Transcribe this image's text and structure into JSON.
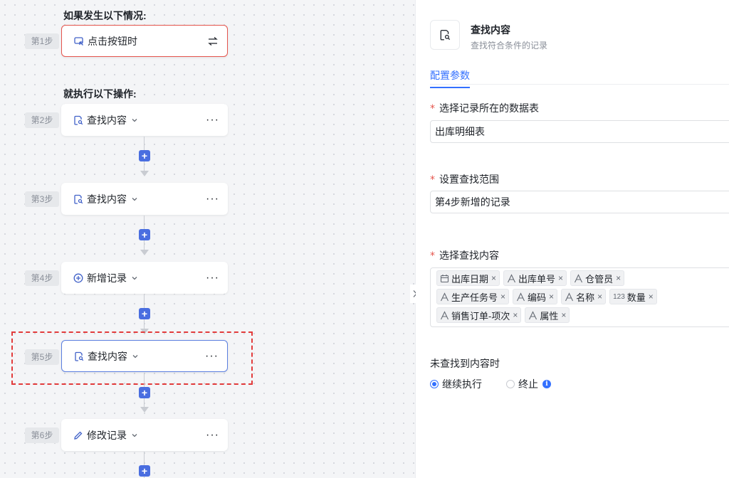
{
  "canvas": {
    "if_title": "如果发生以下情况:",
    "then_title": "就执行以下操作:",
    "steps": [
      {
        "tag": "第1步",
        "label": "点击按钮时",
        "icon": "mouse-click-icon",
        "type": "trigger"
      },
      {
        "tag": "第2步",
        "label": "查找内容",
        "icon": "find-record-icon"
      },
      {
        "tag": "第3步",
        "label": "查找内容",
        "icon": "find-record-icon"
      },
      {
        "tag": "第4步",
        "label": "新增记录",
        "icon": "add-circle-icon"
      },
      {
        "tag": "第5步",
        "label": "查找内容",
        "icon": "find-record-icon",
        "selected": true
      },
      {
        "tag": "第6步",
        "label": "修改记录",
        "icon": "pencil-icon"
      }
    ],
    "more_label": "···",
    "add_label": "+"
  },
  "panel": {
    "title": "查找内容",
    "subtitle": "查找符合条件的记录",
    "tab": "配置参数",
    "required_mark": "*",
    "table_label": "选择记录所在的数据表",
    "table_value": "出库明细表",
    "scope_label": "设置查找范围",
    "scope_value": "第4步新增的记录",
    "content_label": "选择查找内容",
    "fields": [
      [
        {
          "name": "出库日期",
          "icon": "calendar-icon"
        },
        {
          "name": "出库单号",
          "icon": "text-field-icon"
        },
        {
          "name": "仓管员",
          "icon": "text-field-icon"
        }
      ],
      [
        {
          "name": "生产任务号",
          "icon": "text-field-icon"
        },
        {
          "name": "编码",
          "icon": "text-field-icon"
        },
        {
          "name": "名称",
          "icon": "text-field-icon"
        },
        {
          "name": "数量",
          "icon": "number-field-icon",
          "icon_text": "123"
        }
      ],
      [
        {
          "name": "销售订单-项次",
          "icon": "text-field-icon"
        },
        {
          "name": "属性",
          "icon": "text-field-icon"
        }
      ]
    ],
    "not_found_label": "未查找到内容时",
    "option_continue": "继续执行",
    "option_stop": "终止"
  }
}
